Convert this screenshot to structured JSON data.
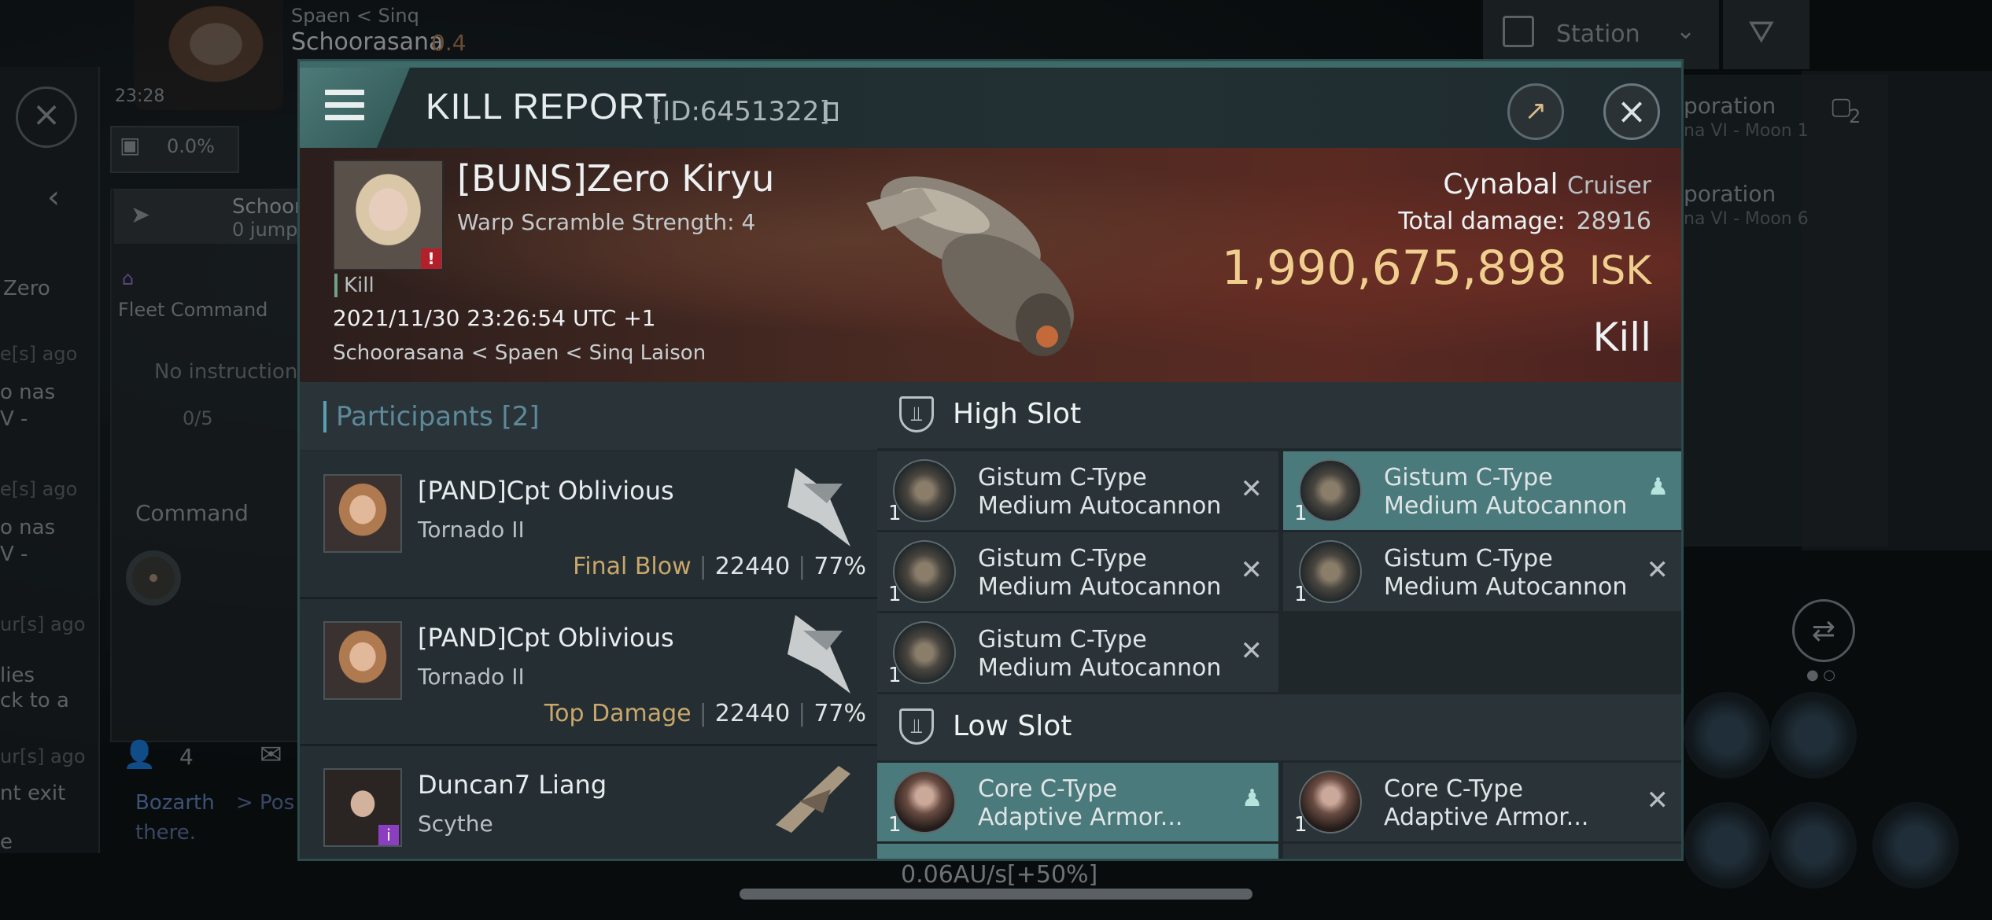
{
  "background": {
    "system_path": "Spaen < Sinq",
    "system_name": "Schoorasana",
    "security": "0.4",
    "clock": "23:28",
    "cargo_pct": "0.0%",
    "nav_label": "Schoor",
    "nav_jumps": "0 jump",
    "fleet_command": "Fleet Command",
    "no_instruction": "No instruction",
    "progress": "0/5",
    "command": "Command",
    "zero": "Zero",
    "member_count": "4",
    "chat_author": "Bozarth",
    "chat_text": "> Pos",
    "chat_text2": "there.",
    "station_filter": "Station",
    "corp1": "poration",
    "corp1_sub": "na VI - Moon 1",
    "corp2": "poration",
    "corp2_sub": "na VI - Moon 6",
    "badge_num": "2",
    "speed": "0.06AU/s[+50%]",
    "left_fragments": [
      "e[s] ago",
      "o nas",
      "V -",
      "e[s] ago",
      "o nas",
      "V -",
      "ur[s] ago",
      "lies",
      "ck to a",
      "ur[s] ago",
      "nt exit",
      "e"
    ]
  },
  "report": {
    "title": "KILL REPORT",
    "id_text": "[ID:6451322]",
    "victim": {
      "name": "[BUNS]Zero Kiryu",
      "subtitle": "Warp Scramble Strength: 4",
      "tag": "Kill",
      "datetime": "2021/11/30 23:26:54 UTC +1",
      "location": "Schoorasana < Spaen < Sinq Laison"
    },
    "ship": {
      "name": "Cynabal",
      "class": "Cruiser",
      "damage_label": "Total damage:",
      "damage_value": "28916",
      "isk_value": "1,990,675,898",
      "isk_unit": "ISK",
      "result": "Kill"
    },
    "participants": {
      "title": "Participants",
      "count": "[2]",
      "rows": [
        {
          "name": "[PAND]Cpt Oblivious",
          "ship": "Tornado II",
          "role": "Final Blow",
          "damage": "22440",
          "pct": "77%"
        },
        {
          "name": "[PAND]Cpt Oblivious",
          "ship": "Tornado II",
          "role": "Top Damage",
          "damage": "22440",
          "pct": "77%"
        },
        {
          "name": "Duncan7 Liang",
          "ship": "Scythe",
          "role": "",
          "damage": "",
          "pct": ""
        }
      ]
    },
    "high_slot": {
      "title": "High Slot",
      "modules": [
        {
          "line1": "Gistum C-Type",
          "line2": "Medium Autocannon",
          "qty": "1",
          "status": "destroyed"
        },
        {
          "line1": "Gistum C-Type",
          "line2": "Medium Autocannon",
          "qty": "1",
          "status": "dropped"
        },
        {
          "line1": "Gistum C-Type",
          "line2": "Medium Autocannon",
          "qty": "1",
          "status": "destroyed"
        },
        {
          "line1": "Gistum C-Type",
          "line2": "Medium Autocannon",
          "qty": "1",
          "status": "destroyed"
        },
        {
          "line1": "Gistum C-Type",
          "line2": "Medium Autocannon",
          "qty": "1",
          "status": "destroyed"
        }
      ]
    },
    "low_slot": {
      "title": "Low Slot",
      "modules": [
        {
          "line1": "Core C-Type",
          "line2": "Adaptive Armor...",
          "qty": "1",
          "status": "dropped"
        },
        {
          "line1": "Core C-Type",
          "line2": "Adaptive Armor...",
          "qty": "1",
          "status": "destroyed"
        }
      ]
    }
  },
  "colors": {
    "accent": "#4a7a7c",
    "isk": "#f0cf8e",
    "role": "#c9a76a",
    "participants": "#5c8a9a"
  }
}
